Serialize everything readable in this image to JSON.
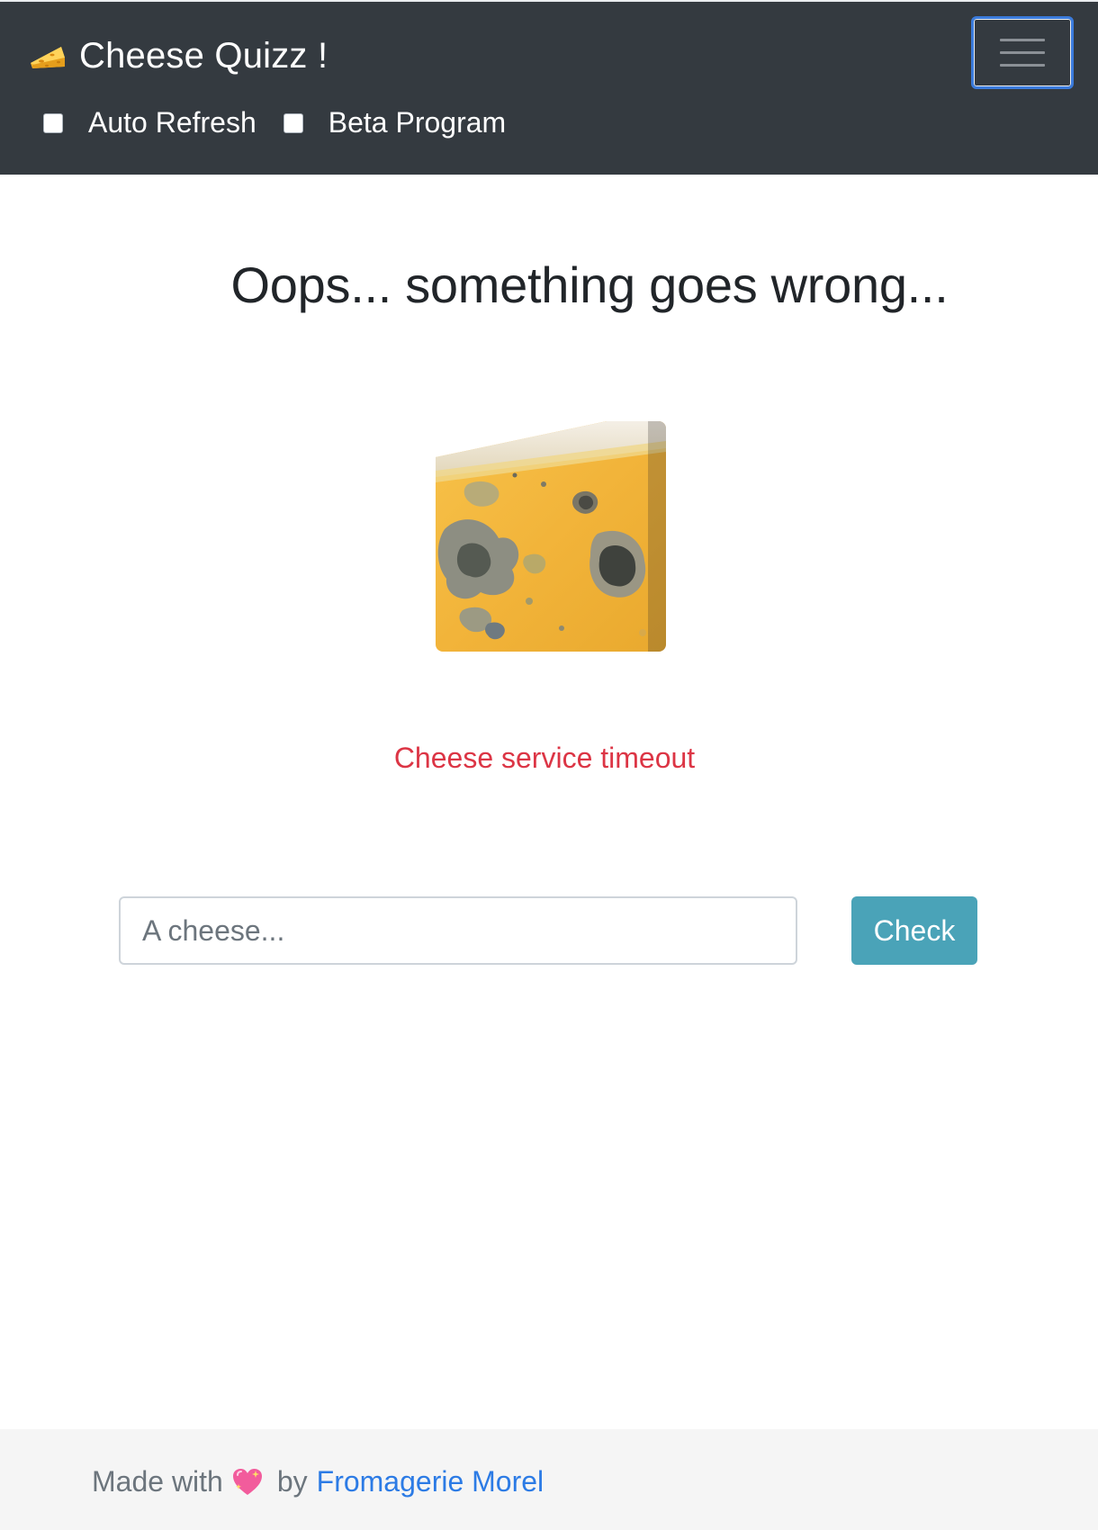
{
  "navbar": {
    "brand_icon": "cheese-icon",
    "brand_label": "Cheese Quizz !",
    "menu_icon": "hamburger-menu-icon",
    "checkboxes": [
      {
        "label": "Auto Refresh",
        "checked": false
      },
      {
        "label": "Beta Program",
        "checked": false
      }
    ]
  },
  "main": {
    "title": "Oops... something goes wrong...",
    "image": "moldy-cheese-image",
    "error_message": "Cheese service timeout",
    "input": {
      "placeholder": "A cheese...",
      "value": ""
    },
    "check_label": "Check"
  },
  "footer": {
    "made_with": "Made with",
    "heart_icon": "sparkling-heart-icon",
    "by": "by",
    "link_label": "Fromagerie Morel"
  },
  "colors": {
    "navbar_bg": "#343a40",
    "error": "#dc3545",
    "button": "#4aa3b8",
    "link": "#2c7be5",
    "footer_bg": "#f5f5f5"
  }
}
